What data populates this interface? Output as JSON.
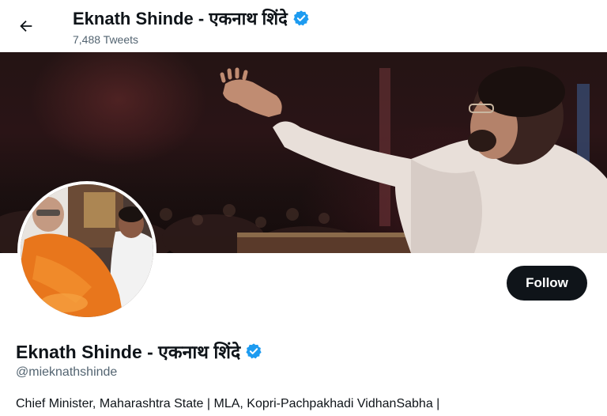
{
  "header": {
    "title": "Eknath Shinde - एकनाथ शिंदे",
    "tweet_count": "7,488 Tweets",
    "back_icon": "arrow-left-icon"
  },
  "banner": {
    "description_icon": "profile-banner-image"
  },
  "profile": {
    "name": "Eknath Shinde - एकनाथ शिंदे",
    "handle": "@mieknathshinde",
    "bio": "Chief Minister, Maharashtra State | MLA, Kopri-Pachpakhadi VidhanSabha |",
    "verified_icon": "verified-badge-icon",
    "verified_color": "#1d9bf0"
  },
  "actions": {
    "follow_label": "Follow",
    "follow_bg": "#0f1419"
  }
}
